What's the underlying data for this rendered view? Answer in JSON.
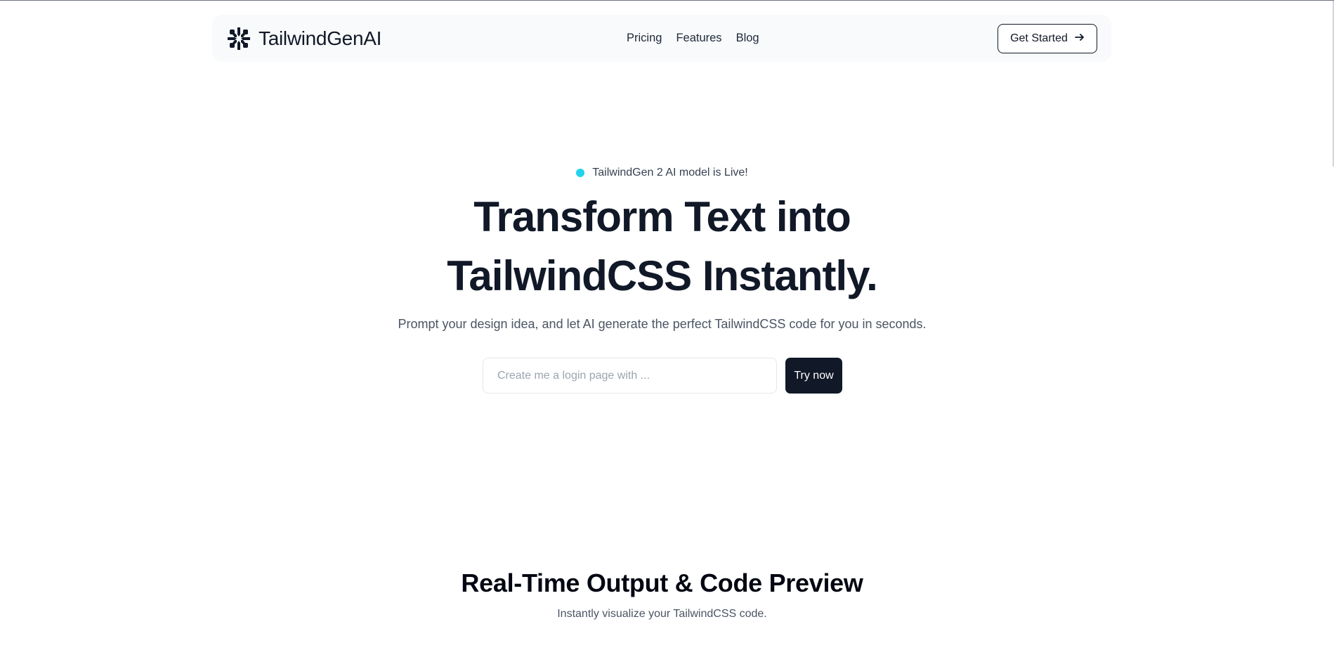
{
  "header": {
    "brand_name": "TailwindGenAI",
    "nav": [
      {
        "label": "Pricing"
      },
      {
        "label": "Features"
      },
      {
        "label": "Blog"
      }
    ],
    "cta_label": "Get Started",
    "cta_icon": "arrow-right-icon"
  },
  "hero": {
    "announcement": "TailwindGen 2 AI model is Live!",
    "announcement_dot_color": "#22d3ee",
    "title_line1": "Transform Text into",
    "title_line2": "TailwindCSS Instantly.",
    "subtitle": "Prompt your design idea, and let AI generate the perfect TailwindCSS code for you in seconds.",
    "input_value": "",
    "input_placeholder": "Create me a login page with ...",
    "try_button_label": "Try now"
  },
  "preview_section": {
    "title": "Real-Time Output & Code Preview",
    "subtitle": "Instantly visualize your TailwindCSS code."
  },
  "colors": {
    "primary_dark": "#111827",
    "header_bg": "#f8fafc",
    "accent_cyan": "#22d3ee"
  }
}
